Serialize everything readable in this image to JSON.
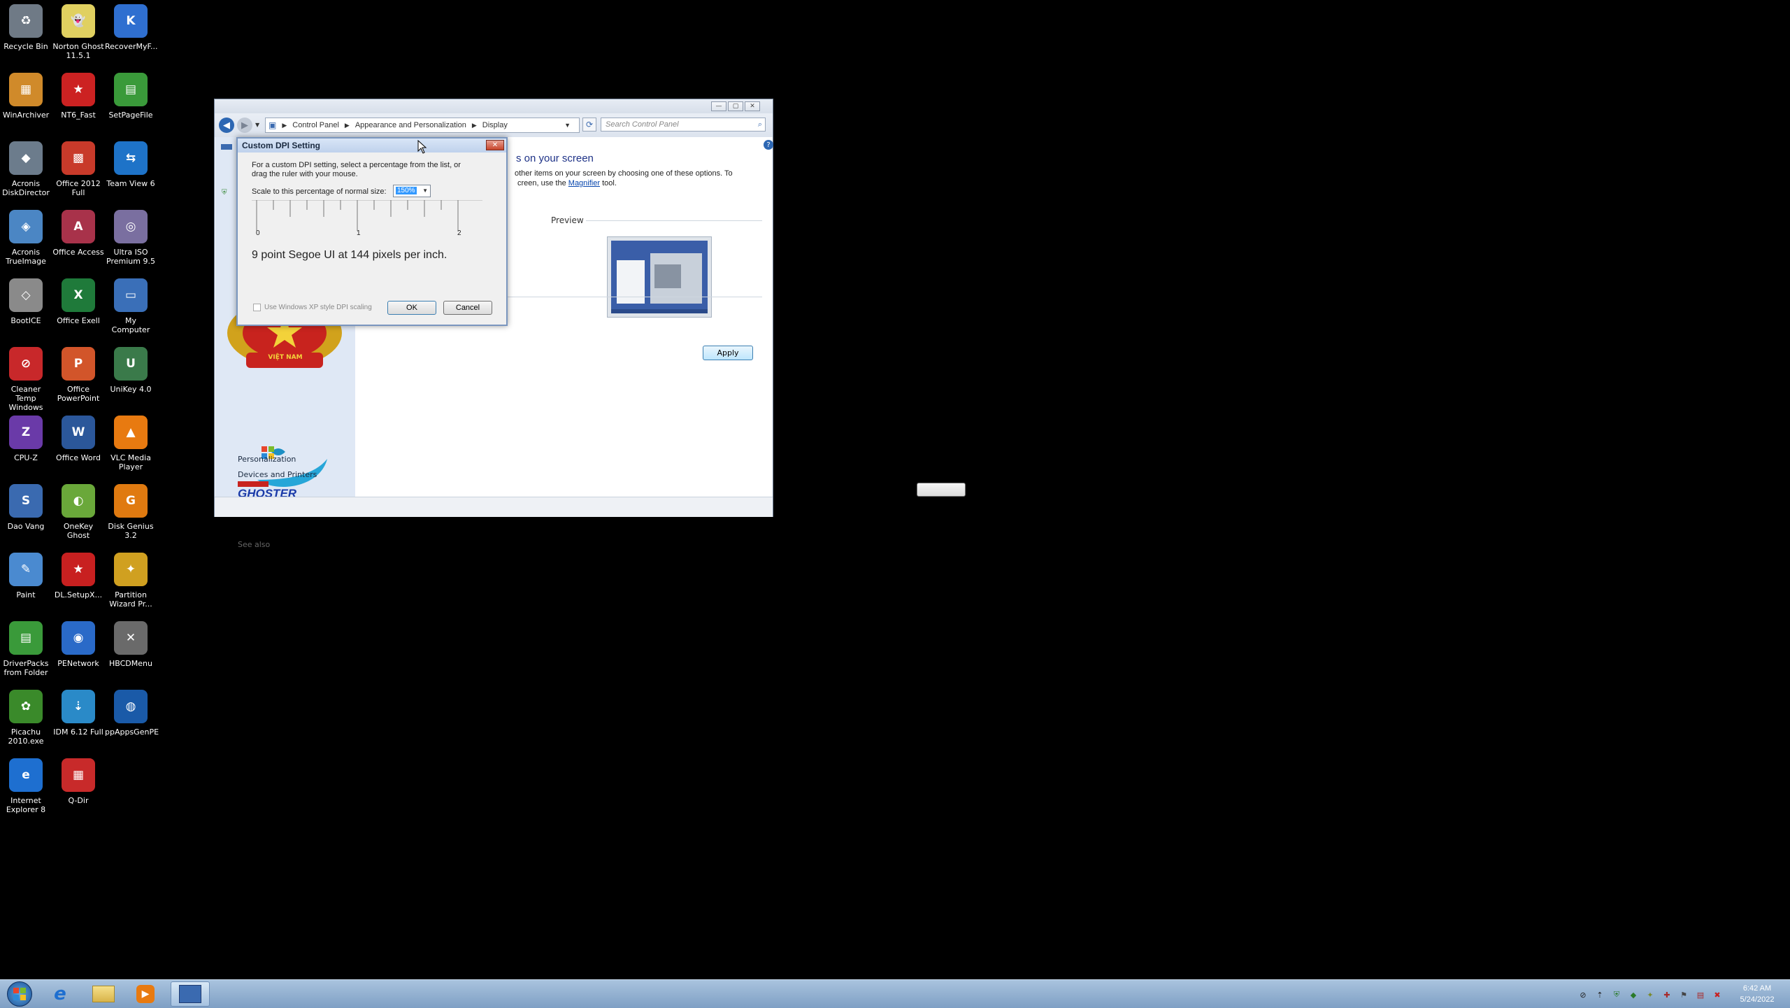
{
  "desktop_icons": [
    {
      "label": "Recycle Bin",
      "icon": "recycle-bin-icon",
      "color": "#6f7a86",
      "glyph": "♻"
    },
    {
      "label": "Norton Ghost 11.5.1",
      "icon": "norton-ghost-icon",
      "color": "#e0d060",
      "glyph": "👻"
    },
    {
      "label": "RecoverMyF...",
      "icon": "recover-my-files-icon",
      "color": "#2f6fd0",
      "glyph": "K"
    },
    {
      "label": "WinArchiver",
      "icon": "winarchiver-icon",
      "color": "#d08a2a",
      "glyph": "▦"
    },
    {
      "label": "NT6_Fast",
      "icon": "nt6-fast-icon",
      "color": "#cc2222",
      "glyph": "★"
    },
    {
      "label": "SetPageFile",
      "icon": "setpagefile-icon",
      "color": "#3a9a3a",
      "glyph": "▤"
    },
    {
      "label": "Acronis DiskDirector",
      "icon": "acronis-diskdirector-icon",
      "color": "#6c7c8c",
      "glyph": "◆"
    },
    {
      "label": "Office 2012 Full",
      "icon": "office-2012-icon",
      "color": "#c83a2a",
      "glyph": "▩"
    },
    {
      "label": "Team View 6",
      "icon": "teamviewer-icon",
      "color": "#1e73c8",
      "glyph": "⇆"
    },
    {
      "label": "Acronis TrueImage",
      "icon": "acronis-trueimage-icon",
      "color": "#4b86c4",
      "glyph": "◈"
    },
    {
      "label": "Office Access",
      "icon": "office-access-icon",
      "color": "#a8324a",
      "glyph": "A"
    },
    {
      "label": "Ultra ISO Premium 9.5",
      "icon": "ultraiso-icon",
      "color": "#7a6fa0",
      "glyph": "◎"
    },
    {
      "label": "BootICE",
      "icon": "bootice-icon",
      "color": "#8a8a8a",
      "glyph": "◇"
    },
    {
      "label": "Office Exell",
      "icon": "office-excel-icon",
      "color": "#1f7a3a",
      "glyph": "X"
    },
    {
      "label": "My Computer",
      "icon": "my-computer-icon",
      "color": "#3a6fb8",
      "glyph": "▭"
    },
    {
      "label": "Cleaner Temp Windows",
      "icon": "cleaner-temp-icon",
      "color": "#c8282a",
      "glyph": "⊘"
    },
    {
      "label": "Office PowerPoint",
      "icon": "office-powerpoint-icon",
      "color": "#d2552a",
      "glyph": "P"
    },
    {
      "label": "UniKey 4.0",
      "icon": "unikey-icon",
      "color": "#3a7a4a",
      "glyph": "U"
    },
    {
      "label": "CPU-Z",
      "icon": "cpu-z-icon",
      "color": "#6a3aa8",
      "glyph": "Z"
    },
    {
      "label": "Office Word",
      "icon": "office-word-icon",
      "color": "#2b579a",
      "glyph": "W"
    },
    {
      "label": "VLC Media Player",
      "icon": "vlc-icon",
      "color": "#e87a10",
      "glyph": "▲"
    },
    {
      "label": "Dao Vang",
      "icon": "dao-vang-icon",
      "color": "#3a6ab0",
      "glyph": "S"
    },
    {
      "label": "OneKey Ghost",
      "icon": "onekey-ghost-icon",
      "color": "#6aa83a",
      "glyph": "◐"
    },
    {
      "label": "Disk Genius 3.2",
      "icon": "disk-genius-icon",
      "color": "#e07a10",
      "glyph": "G"
    },
    {
      "label": "Paint",
      "icon": "paint-icon",
      "color": "#4a8ad0",
      "glyph": "✎"
    },
    {
      "label": "DL.SetupX...",
      "icon": "dl-setup-icon",
      "color": "#c82020",
      "glyph": "★"
    },
    {
      "label": "Partition Wizard Pr...",
      "icon": "partition-wizard-icon",
      "color": "#d0a020",
      "glyph": "✦"
    },
    {
      "label": "DriverPacks from Folder",
      "icon": "driverpacks-icon",
      "color": "#3a9a3a",
      "glyph": "▤"
    },
    {
      "label": "PENetwork",
      "icon": "penetwork-icon",
      "color": "#2a6ac8",
      "glyph": "◉"
    },
    {
      "label": "HBCDMenu",
      "icon": "hbcdmenu-icon",
      "color": "#6a6a6a",
      "glyph": "✕"
    },
    {
      "label": "Picachu 2010.exe",
      "icon": "picachu-icon",
      "color": "#3a8a2a",
      "glyph": "✿"
    },
    {
      "label": "IDM 6.12 Full",
      "icon": "idm-icon",
      "color": "#2a8ac8",
      "glyph": "⇣"
    },
    {
      "label": "ppAppsGenPE",
      "icon": "ppappsgenpe-icon",
      "color": "#1a5aa8",
      "glyph": "◍"
    },
    {
      "label": "Internet Explorer 8",
      "icon": "internet-explorer-icon",
      "color": "#1e6fd0",
      "glyph": "e"
    },
    {
      "label": "Q-Dir",
      "icon": "q-dir-icon",
      "color": "#c82a2a",
      "glyph": "▦"
    }
  ],
  "control_panel": {
    "breadcrumbs": [
      "Control Panel",
      "Appearance and Personalization",
      "Display"
    ],
    "search_placeholder": "Search Control Panel",
    "heading_partial": "s on your screen",
    "desc_line1": "other items on your screen by choosing one of these options. To",
    "desc_line2_before": "creen, use the ",
    "desc_link": "Magnifier",
    "desc_line2_after": " tool.",
    "preview_label": "Preview",
    "apply_label": "Apply",
    "see_also_label": "See also",
    "see_also_items": [
      "Personalization",
      "Devices and Printers"
    ],
    "logo_text": "VIỆT NAM",
    "ghoster_text": "GHOSTER"
  },
  "dpi_dialog": {
    "title": "Custom DPI Setting",
    "instructions_line1": "For a custom DPI setting, select a percentage from the list, or",
    "instructions_line2": "drag the ruler with your mouse.",
    "scale_label": "Scale to this percentage of normal size:",
    "scale_value": "150%",
    "ruler_labels": [
      "0",
      "1",
      "2"
    ],
    "sample_text": "9 point Segoe UI at 144 pixels per inch.",
    "xp_scaling_label": "Use Windows XP style DPI scaling",
    "xp_scaling_checked": false,
    "ok_label": "OK",
    "cancel_label": "Cancel"
  },
  "taskbar": {
    "clock_time": "6:42 AM",
    "clock_date": "5/24/2022"
  }
}
